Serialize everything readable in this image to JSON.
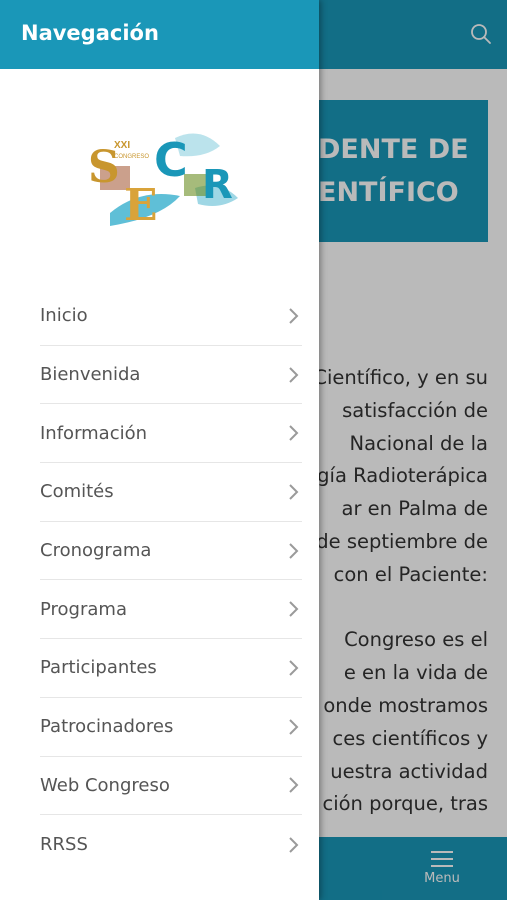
{
  "drawer": {
    "title": "Navegación",
    "items": [
      {
        "label": "Inicio"
      },
      {
        "label": "Bienvenida"
      },
      {
        "label": "Información"
      },
      {
        "label": "Comités"
      },
      {
        "label": "Cronograma"
      },
      {
        "label": "Programa"
      },
      {
        "label": "Participantes"
      },
      {
        "label": "Patrocinadores"
      },
      {
        "label": "Web Congreso"
      },
      {
        "label": "RRSS"
      }
    ]
  },
  "logo": {
    "top_text": "XXI",
    "sub_text": "CONGRESO",
    "letters": [
      "S",
      "E",
      "C",
      "R"
    ]
  },
  "page": {
    "hero_line1": "DENTE DE",
    "hero_line2": "ENTÍFICO",
    "paragraph1": [
      "Científico, y en su",
      "satisfacción de",
      "Nacional de la",
      "gía Radioterápica",
      "ar en Palma de",
      "de septiembre de",
      "con el Paciente:"
    ],
    "paragraph2": [
      "Congreso es el",
      "e en la vida de",
      "onde mostramos",
      "ces científicos y",
      "uestra actividad",
      "ción porque, tras"
    ]
  },
  "bottom_bar": {
    "menu_label": "Menu"
  },
  "colors": {
    "primary": "#1a97b8",
    "text": "#555555"
  }
}
